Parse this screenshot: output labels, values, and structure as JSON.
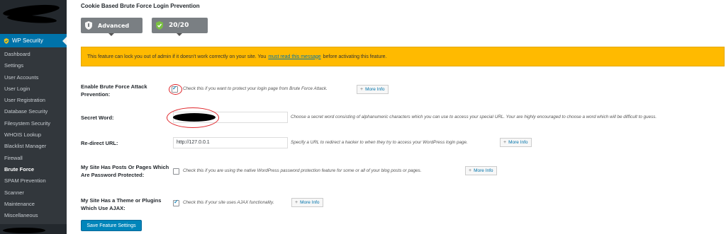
{
  "sidebar": {
    "plugin_label": "WP Security",
    "items": [
      {
        "label": "Dashboard"
      },
      {
        "label": "Settings"
      },
      {
        "label": "User Accounts"
      },
      {
        "label": "User Login"
      },
      {
        "label": "User Registration"
      },
      {
        "label": "Database Security"
      },
      {
        "label": "Filesystem Security"
      },
      {
        "label": "WHOIS Lookup"
      },
      {
        "label": "Blacklist Manager"
      },
      {
        "label": "Firewall"
      },
      {
        "label": "Brute Force",
        "active": true
      },
      {
        "label": "SPAM Prevention"
      },
      {
        "label": "Scanner"
      },
      {
        "label": "Maintenance"
      },
      {
        "label": "Miscellaneous"
      }
    ]
  },
  "section": {
    "title": "Cookie Based Brute Force Login Prevention"
  },
  "badges": {
    "level": "Advanced",
    "score": "20/20"
  },
  "warning": {
    "text_before": "This feature can lock you out of admin if it doesn't work correctly on your site. You",
    "link": "must read this message",
    "text_after": "before activating this feature."
  },
  "settings": {
    "enable": {
      "label": "Enable Brute Force Attack Prevention:",
      "checked": true,
      "description": "Check this if you want to protect your login page from Brute Force Attack."
    },
    "secret": {
      "label": "Secret Word:",
      "value": "",
      "description": "Choose a secret word consisting of alphanumeric characters which you can use to access your special URL. Your are highly encouraged to choose a word which will be difficult to guess."
    },
    "redirect": {
      "label": "Re-direct URL:",
      "value": "http://127.0.0.1",
      "description": "Specify a URL to redirect a hacker to when they try to access your WordPress login page."
    },
    "password_posts": {
      "label": "My Site Has Posts Or Pages Which Are Password Protected:",
      "checked": false,
      "description": "Check this if you are using the native WordPress password protection feature for some or all of your blog posts or pages."
    },
    "ajax": {
      "label": "My Site Has a Theme or Plugins Which Use AJAX:",
      "checked": true,
      "description": "Check this if your site uses AJAX functionality."
    }
  },
  "more_info_label": "More Info",
  "more_info_plus": "+",
  "save_button": "Save Feature Settings",
  "check_glyph": "✓",
  "colors": {
    "sidebar_bg": "#23282d",
    "submenu_bg": "#32373c",
    "accent": "#0073aa",
    "warning_bg": "#ffba00",
    "button_bg": "#0085ba",
    "badge_bg": "#7a7f83",
    "annotation_red": "#e0262b"
  },
  "icons": {
    "shield": "shield-icon",
    "shield_check": "shield-check-icon"
  }
}
